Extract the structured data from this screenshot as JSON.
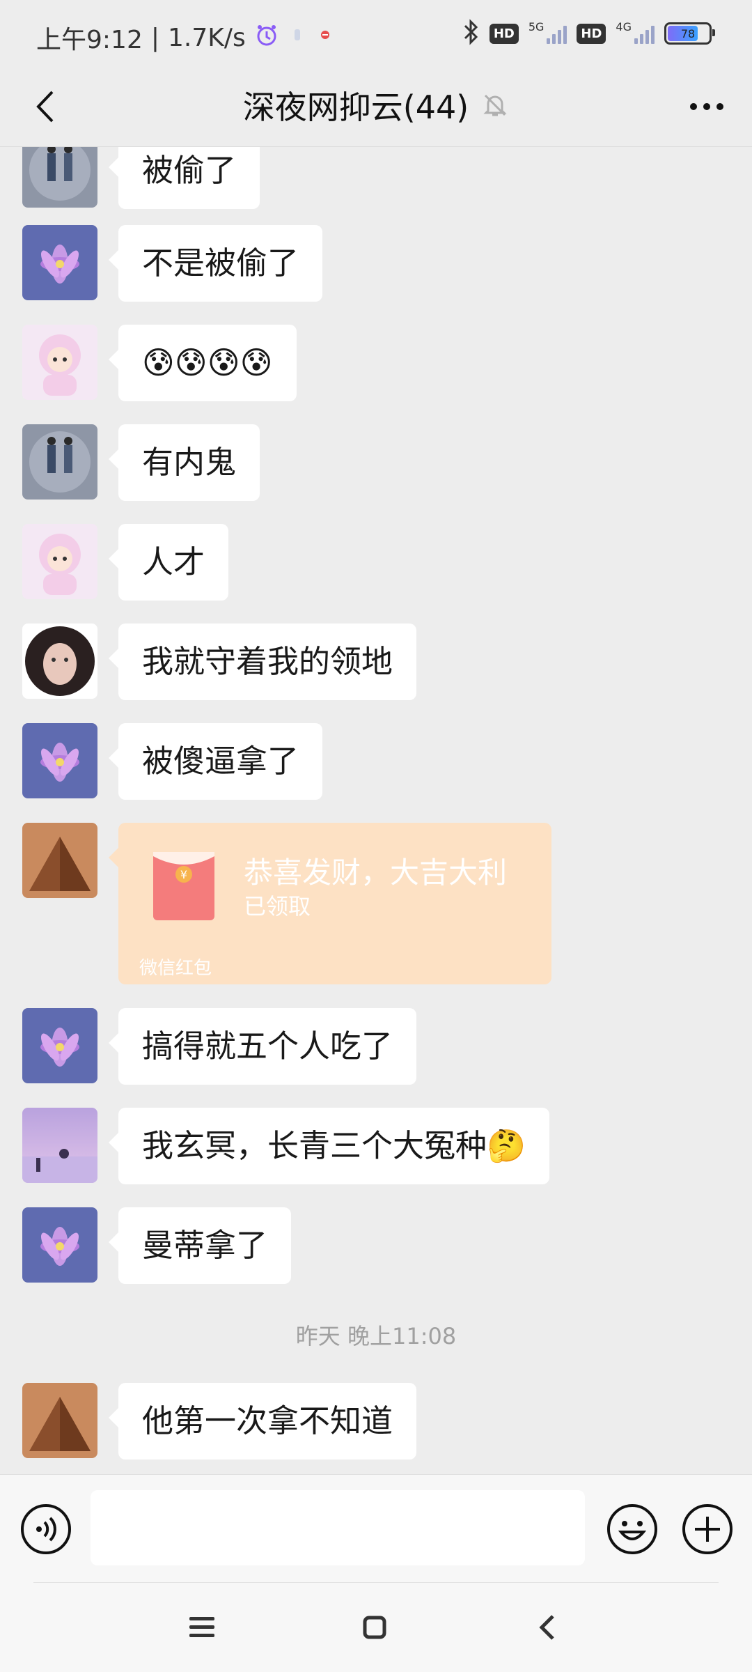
{
  "status_bar": {
    "time": "上午9:12",
    "separator": "|",
    "net_speed": "1.7K/s",
    "icons": [
      "alarm-icon",
      "notification-icon",
      "notification-icon",
      "bluetooth-icon"
    ],
    "hd1": "HD",
    "net1": "5G",
    "hd2": "HD",
    "net2": "4G",
    "battery": "78"
  },
  "header": {
    "title": "深夜网抑云(44)",
    "mute_icon": "bell-off-icon",
    "back_icon": "back-icon",
    "more_icon": "more-icon"
  },
  "messages": [
    {
      "text": "被偷了",
      "avatar": "couple"
    },
    {
      "text": "不是被偷了",
      "avatar": "lotus"
    },
    {
      "text": "😰😰😰😰",
      "avatar": "anime"
    },
    {
      "text": "有内鬼",
      "avatar": "couple"
    },
    {
      "text": "人才",
      "avatar": "anime"
    },
    {
      "text": "我就守着我的领地",
      "avatar": "girl"
    },
    {
      "text": "被傻逼拿了",
      "avatar": "lotus"
    },
    {
      "text": "搞得就五个人吃了",
      "avatar": "lotus"
    },
    {
      "text": "我玄冥，长青三个大冤种🤔",
      "avatar": "sunset"
    },
    {
      "text": "曼蒂拿了",
      "avatar": "lotus"
    },
    {
      "text": "他第一次拿不知道",
      "avatar": "pyramid"
    }
  ],
  "red_packet": {
    "title": "恭喜发财，大吉大利",
    "status": "已领取",
    "label": "微信红包",
    "avatar": "pyramid"
  },
  "timestamp": "昨天 晚上11:08",
  "input_bar": {
    "voice_icon": "voice-icon",
    "emoji_icon": "emoji-icon",
    "plus_icon": "plus-icon",
    "input_value": ""
  },
  "nav_bar": {
    "menu_icon": "menu-icon",
    "home_icon": "home-icon",
    "back_icon": "back-icon"
  },
  "colors": {
    "chat_bg": "#ededed",
    "bubble": "#ffffff",
    "red_packet": "#fde1c4",
    "red_envelope": "#f26d6d"
  }
}
